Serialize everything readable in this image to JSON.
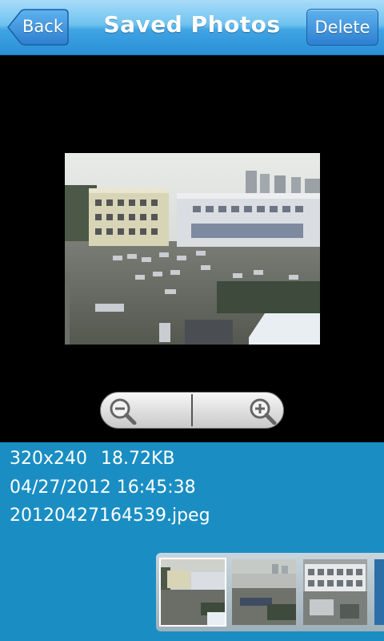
{
  "header": {
    "title": "Saved Photos",
    "back_label": "Back",
    "delete_label": "Delete"
  },
  "zoom": {
    "zoom_out_icon": "zoom-out-icon",
    "zoom_in_icon": "zoom-in-icon"
  },
  "photo_info": {
    "resolution": "320x240",
    "file_size": "18.72KB",
    "date": "04/27/2012 16:45:38",
    "filename": "20120427164539.jpeg"
  },
  "colors": {
    "title_bar": "#3fa4e4",
    "info_panel": "#1a8ec3"
  }
}
